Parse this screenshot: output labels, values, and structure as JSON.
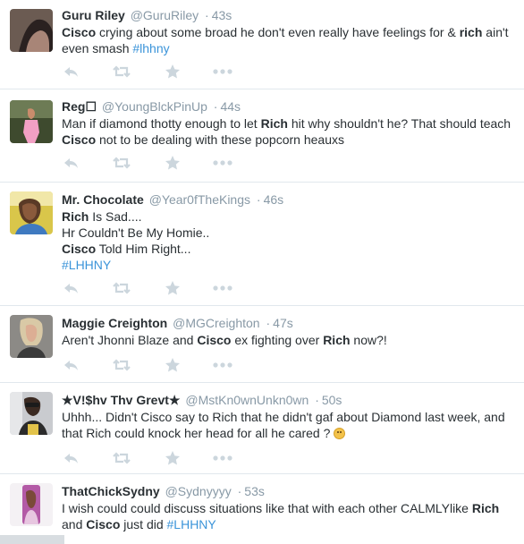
{
  "colors": {
    "link": "#3b94d9",
    "muted": "#8899a6",
    "text": "#292f33",
    "divider": "#e1e8ed"
  },
  "icons": {
    "reply": "reply-icon",
    "retweet": "retweet-icon",
    "favorite": "favorite-icon",
    "more": "more-icon"
  },
  "tweets": [
    {
      "name": "Guru Riley",
      "handle": "@GuruRiley",
      "sep": "·",
      "time": "43s",
      "t1": "Cisco",
      "t2": " crying about some broad he don't even really have feelings for & ",
      "t3": "rich",
      "t4": " ain't even smash  ",
      "t5": "#lhhny"
    },
    {
      "name": "Reg☐",
      "handle": "@YoungBlckPinUp",
      "sep": "·",
      "time": "44s",
      "t1": "Man if diamond thotty enough to let ",
      "t2": "Rich",
      "t3": " hit why shouldn't he? That should teach ",
      "t4": "Cisco",
      "t5": " not to be dealing with these popcorn heauxs"
    },
    {
      "name": "Mr. Chocolate",
      "handle": "@Year0fTheKings",
      "sep": "·",
      "time": "46s",
      "l1a": "Rich",
      "l1b": " Is Sad....",
      "l2": "Hr Couldn't Be My Homie..",
      "l3a": "Cisco",
      "l3b": " Told Him Right...",
      "l4": "#LHHNY"
    },
    {
      "name": "Maggie Creighton",
      "handle": "@MGCreighton",
      "sep": "·",
      "time": "47s",
      "t1": "Aren't Jhonni Blaze and ",
      "t2": "Cisco",
      "t3": "  ex fighting over ",
      "t4": "Rich",
      "t5": " now?!"
    },
    {
      "name": "★V!$hv Thv Grevt★",
      "handle": "@MstKn0wnUnkn0wn",
      "sep": "·",
      "time": "50s",
      "t1": "Uhhh... Didn't Cisco say to Rich that he didn't gaf about Diamond last week, and that Rich could knock her head for all he cared ? "
    },
    {
      "name": "ThatChickSydny",
      "handle": "@Sydnyyyy",
      "sep": "·",
      "time": "53s",
      "t1": "I wish could could discuss situations like that with each other CALMLYlike ",
      "t2": "Rich",
      "t3": "and ",
      "t4": "Cisco",
      "t5": " just did ",
      "t6": "#LHHNY"
    }
  ]
}
